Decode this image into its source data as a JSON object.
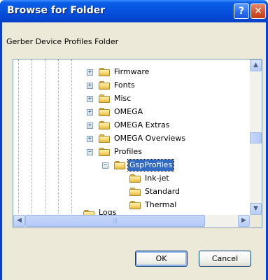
{
  "window": {
    "title": "Browse for Folder"
  },
  "titlebar": {
    "help": "?",
    "close": "✕"
  },
  "description": "Gerber Device Profiles Folder",
  "tree": {
    "items": [
      {
        "label": "Firmware",
        "expander": "+"
      },
      {
        "label": "Fonts",
        "expander": "+"
      },
      {
        "label": "Misc",
        "expander": "+"
      },
      {
        "label": "OMEGA",
        "expander": "+"
      },
      {
        "label": "OMEGA Extras",
        "expander": "+"
      },
      {
        "label": "OMEGA Overviews",
        "expander": "+"
      },
      {
        "label": "Profiles",
        "expander": "−"
      },
      {
        "label": "GspProfiles",
        "expander": "−",
        "selected": true
      },
      {
        "label": "Ink-jet",
        "expander": ""
      },
      {
        "label": "Standard",
        "expander": ""
      },
      {
        "label": "Thermal",
        "expander": ""
      },
      {
        "label": "Logs",
        "expander": ""
      }
    ]
  },
  "scroll": {
    "up": "▲",
    "down": "▼",
    "left": "◀",
    "right": "▶",
    "grip": "|||"
  },
  "buttons": {
    "ok": "OK",
    "cancel": "Cancel"
  }
}
